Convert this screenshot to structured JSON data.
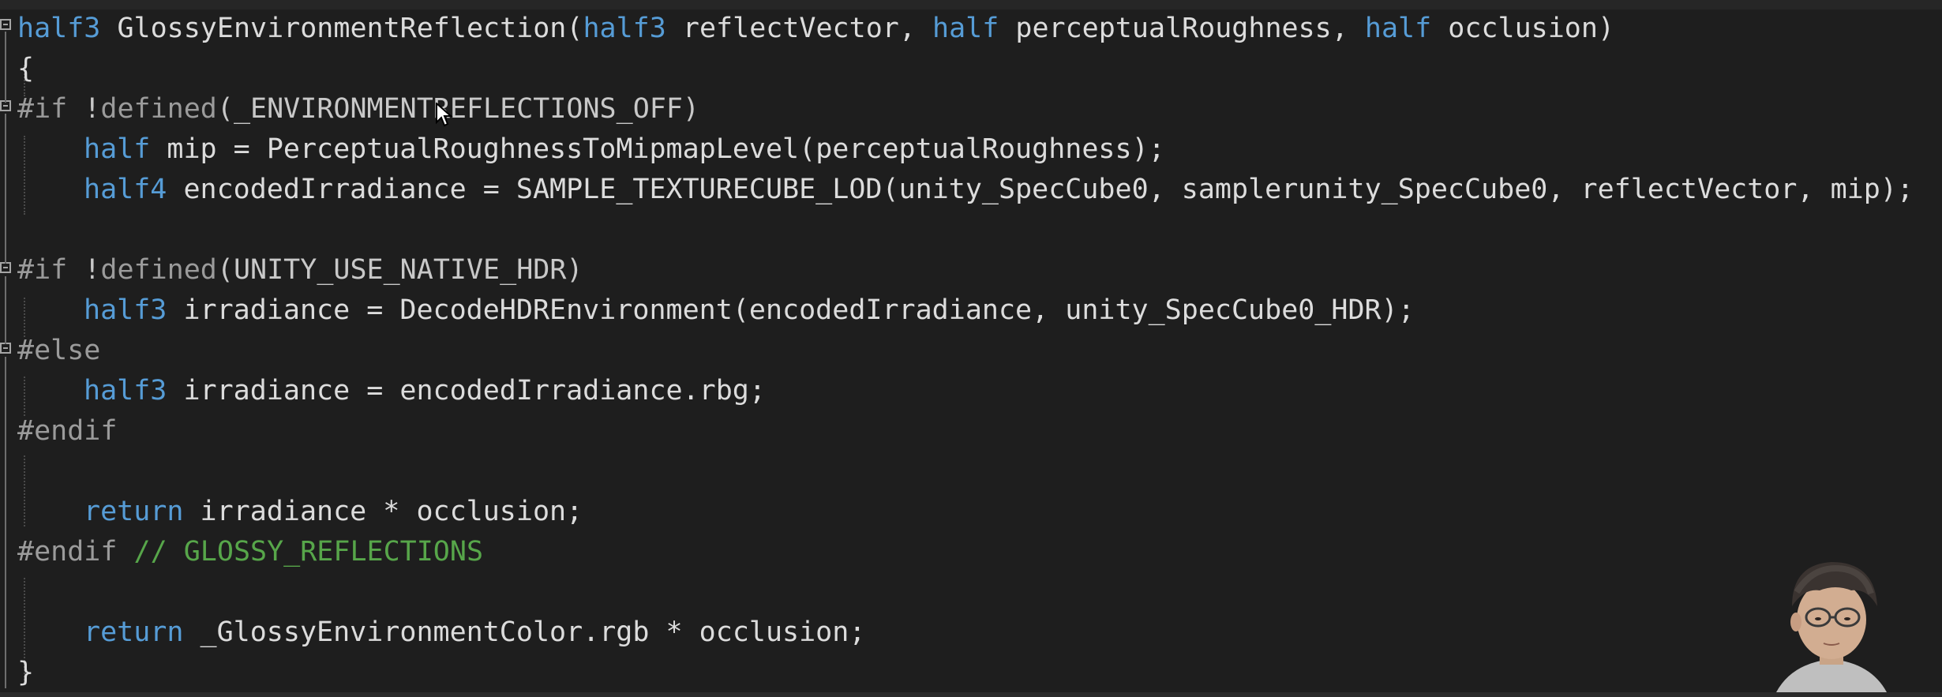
{
  "editor": {
    "lines": {
      "l1": {
        "type": "half3",
        "fn": "GlossyEnvironmentReflection",
        "p1t": "half3",
        "p1": "reflectVector",
        "p2t": "half",
        "p2": "perceptualRoughness",
        "p3t": "half",
        "p3": "occlusion"
      },
      "l2": {
        "brace": "{"
      },
      "l3": {
        "directive": "#if",
        "not": "!",
        "defined": "defined",
        "macro": "_ENVIRONMENTREFLECTIONS_OFF"
      },
      "l4": {
        "type": "half",
        "var": "mip",
        "fn": "PerceptualRoughnessToMipmapLevel",
        "arg": "perceptualRoughness"
      },
      "l5": {
        "type": "half4",
        "var": "encodedIrradiance",
        "fn": "SAMPLE_TEXTURECUBE_LOD",
        "args": "unity_SpecCube0, samplerunity_SpecCube0, reflectVector, mip"
      },
      "l6": {
        "directive": "#if",
        "not": "!",
        "defined": "defined",
        "macro": "UNITY_USE_NATIVE_HDR"
      },
      "l7": {
        "type": "half3",
        "var": "irradiance",
        "fn": "DecodeHDREnvironment",
        "args": "encodedIrradiance, unity_SpecCube0_HDR"
      },
      "l8": {
        "directive": "#else"
      },
      "l9": {
        "type": "half3",
        "var": "irradiance",
        "expr": "encodedIrradiance.rbg"
      },
      "l10": {
        "directive": "#endif"
      },
      "l11": {
        "kw": "return",
        "expr": "irradiance * occlusion"
      },
      "l12": {
        "directive": "#endif",
        "comment": "// GLOSSY_REFLECTIONS"
      },
      "l13": {
        "kw": "return",
        "expr": "_GlossyEnvironmentColor.rgb * occlusion"
      },
      "l14": {
        "brace": "}"
      }
    }
  },
  "colors": {
    "background": "#1e1e1e",
    "keyword": "#569cd6",
    "text": "#dcdcdc",
    "preprocessor": "#9b9b9b",
    "comment": "#57a64a"
  },
  "icons": {
    "mouse_cursor": "arrow-cursor-icon",
    "fold": "collapse-minus-icon"
  }
}
